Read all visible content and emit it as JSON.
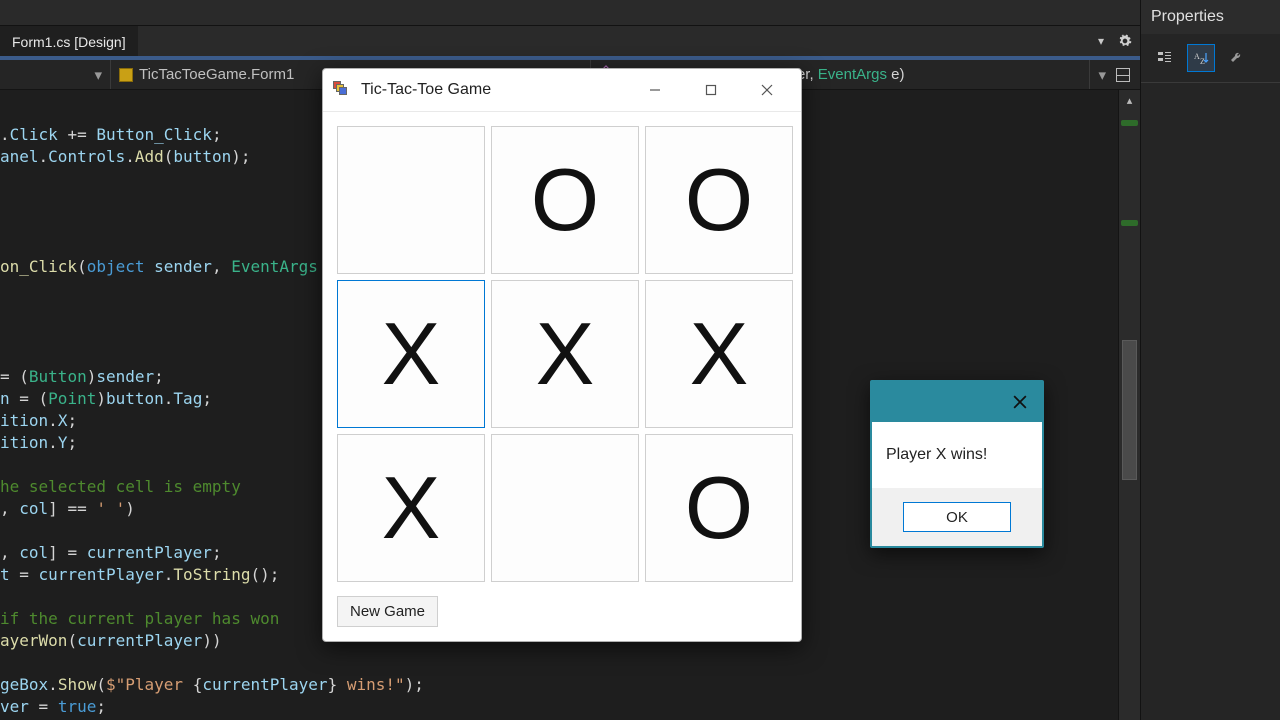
{
  "ide": {
    "document_tab": "Form1.cs [Design]",
    "properties_title": "Properties",
    "nav": {
      "class_label": "TicTacToeGame.Form1",
      "method_label": "Button_Click(object sender, EventArgs e)"
    },
    "code_lines": [
      ".Click += Button_Click;",
      "anel.Controls.Add(button);",
      "",
      "",
      "",
      "",
      "on_Click(object sender, EventArgs e)",
      "",
      "",
      "",
      "",
      "= (Button)sender;",
      "n = (Point)button.Tag;",
      "ition.X;",
      "ition.Y;",
      "",
      "he selected cell is empty",
      ", col] == ' ')",
      "",
      ", col] = currentPlayer;",
      "t = currentPlayer.ToString();",
      "",
      "if the current player has won",
      "ayerWon(currentPlayer))",
      "",
      "geBox.Show($\"Player {currentPlayer} wins!\");",
      "ver = true;"
    ]
  },
  "game_window": {
    "title": "Tic-Tac-Toe Game",
    "new_game_label": "New Game",
    "board": [
      [
        "",
        "O",
        "O"
      ],
      [
        "X",
        "X",
        "X"
      ],
      [
        "X",
        "",
        "O"
      ]
    ],
    "focused_cell": [
      1,
      0
    ]
  },
  "msgbox": {
    "message": "Player X wins!",
    "ok_label": "OK"
  }
}
